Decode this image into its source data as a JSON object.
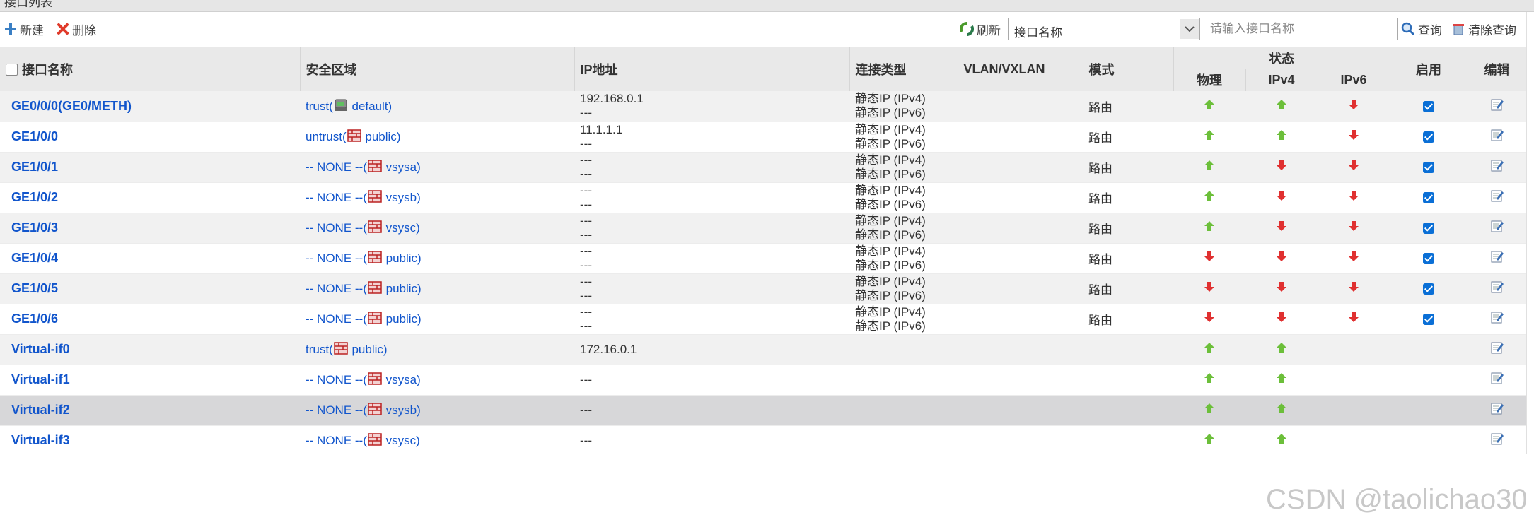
{
  "page": {
    "title": "接口列表"
  },
  "toolbar": {
    "new_label": "新建",
    "delete_label": "删除",
    "refresh_label": "刷新",
    "select_value": "接口名称",
    "search_placeholder": "请输入接口名称",
    "query_label": "查询",
    "clear_label": "清除查询"
  },
  "table": {
    "headers": {
      "name": "接口名称",
      "zone": "安全区域",
      "ip": "IP地址",
      "conn": "连接类型",
      "vlan": "VLAN/VXLAN",
      "mode": "模式",
      "status": "状态",
      "physical": "物理",
      "ipv4": "IPv4",
      "ipv6": "IPv6",
      "enable": "启用",
      "edit": "编辑"
    },
    "rows": [
      {
        "name": "GE0/0/0(GE0/METH)",
        "zone": "trust",
        "zone_icon": "host-icon",
        "vsys": "default",
        "ip1": "192.168.0.1",
        "ip2": "---",
        "conn1": "静态IP (IPv4)",
        "conn2": "静态IP (IPv6)",
        "mode": "路由",
        "phy": "up",
        "v4": "up",
        "v6": "down",
        "enabled": true
      },
      {
        "name": "GE1/0/0",
        "zone": "untrust",
        "zone_icon": "firewall-icon",
        "vsys": "public",
        "ip1": "11.1.1.1",
        "ip2": "---",
        "conn1": "静态IP (IPv4)",
        "conn2": "静态IP (IPv6)",
        "mode": "路由",
        "phy": "up",
        "v4": "up",
        "v6": "down",
        "enabled": true
      },
      {
        "name": "GE1/0/1",
        "zone": "-- NONE --",
        "zone_icon": "firewall-icon",
        "vsys": "vsysa",
        "ip1": "---",
        "ip2": "---",
        "conn1": "静态IP (IPv4)",
        "conn2": "静态IP (IPv6)",
        "mode": "路由",
        "phy": "up",
        "v4": "down",
        "v6": "down",
        "enabled": true
      },
      {
        "name": "GE1/0/2",
        "zone": "-- NONE --",
        "zone_icon": "firewall-icon",
        "vsys": "vsysb",
        "ip1": "---",
        "ip2": "---",
        "conn1": "静态IP (IPv4)",
        "conn2": "静态IP (IPv6)",
        "mode": "路由",
        "phy": "up",
        "v4": "down",
        "v6": "down",
        "enabled": true
      },
      {
        "name": "GE1/0/3",
        "zone": "-- NONE --",
        "zone_icon": "firewall-icon",
        "vsys": "vsysc",
        "ip1": "---",
        "ip2": "---",
        "conn1": "静态IP (IPv4)",
        "conn2": "静态IP (IPv6)",
        "mode": "路由",
        "phy": "up",
        "v4": "down",
        "v6": "down",
        "enabled": true
      },
      {
        "name": "GE1/0/4",
        "zone": "-- NONE --",
        "zone_icon": "firewall-icon",
        "vsys": "public",
        "ip1": "---",
        "ip2": "---",
        "conn1": "静态IP (IPv4)",
        "conn2": "静态IP (IPv6)",
        "mode": "路由",
        "phy": "down",
        "v4": "down",
        "v6": "down",
        "enabled": true
      },
      {
        "name": "GE1/0/5",
        "zone": "-- NONE --",
        "zone_icon": "firewall-icon",
        "vsys": "public",
        "ip1": "---",
        "ip2": "---",
        "conn1": "静态IP (IPv4)",
        "conn2": "静态IP (IPv6)",
        "mode": "路由",
        "phy": "down",
        "v4": "down",
        "v6": "down",
        "enabled": true
      },
      {
        "name": "GE1/0/6",
        "zone": "-- NONE --",
        "zone_icon": "firewall-icon",
        "vsys": "public",
        "ip1": "---",
        "ip2": "---",
        "conn1": "静态IP (IPv4)",
        "conn2": "静态IP (IPv6)",
        "mode": "路由",
        "phy": "down",
        "v4": "down",
        "v6": "down",
        "enabled": true
      },
      {
        "name": "Virtual-if0",
        "zone": "trust",
        "zone_icon": "firewall-icon",
        "vsys": "public",
        "ip1": "172.16.0.1",
        "ip2": "",
        "conn1": "",
        "conn2": "",
        "mode": "",
        "phy": "up",
        "v4": "up",
        "v6": "",
        "enabled": false
      },
      {
        "name": "Virtual-if1",
        "zone": "-- NONE --",
        "zone_icon": "firewall-icon",
        "vsys": "vsysa",
        "ip1": "---",
        "ip2": "",
        "conn1": "",
        "conn2": "",
        "mode": "",
        "phy": "up",
        "v4": "up",
        "v6": "",
        "enabled": false
      },
      {
        "name": "Virtual-if2",
        "zone": "-- NONE --",
        "zone_icon": "firewall-icon",
        "vsys": "vsysb",
        "ip1": "---",
        "ip2": "",
        "conn1": "",
        "conn2": "",
        "mode": "",
        "phy": "up",
        "v4": "up",
        "v6": "",
        "enabled": false,
        "selected": true
      },
      {
        "name": "Virtual-if3",
        "zone": "-- NONE --",
        "zone_icon": "firewall-icon",
        "vsys": "vsysc",
        "ip1": "---",
        "ip2": "",
        "conn1": "",
        "conn2": "",
        "mode": "",
        "phy": "up",
        "v4": "up",
        "v6": "",
        "enabled": false
      }
    ]
  },
  "colors": {
    "link": "#1155cc",
    "up": "#6cbf3a",
    "down": "#e03030",
    "check": "#0a6fd6"
  },
  "watermark": "CSDN @taolichao30"
}
